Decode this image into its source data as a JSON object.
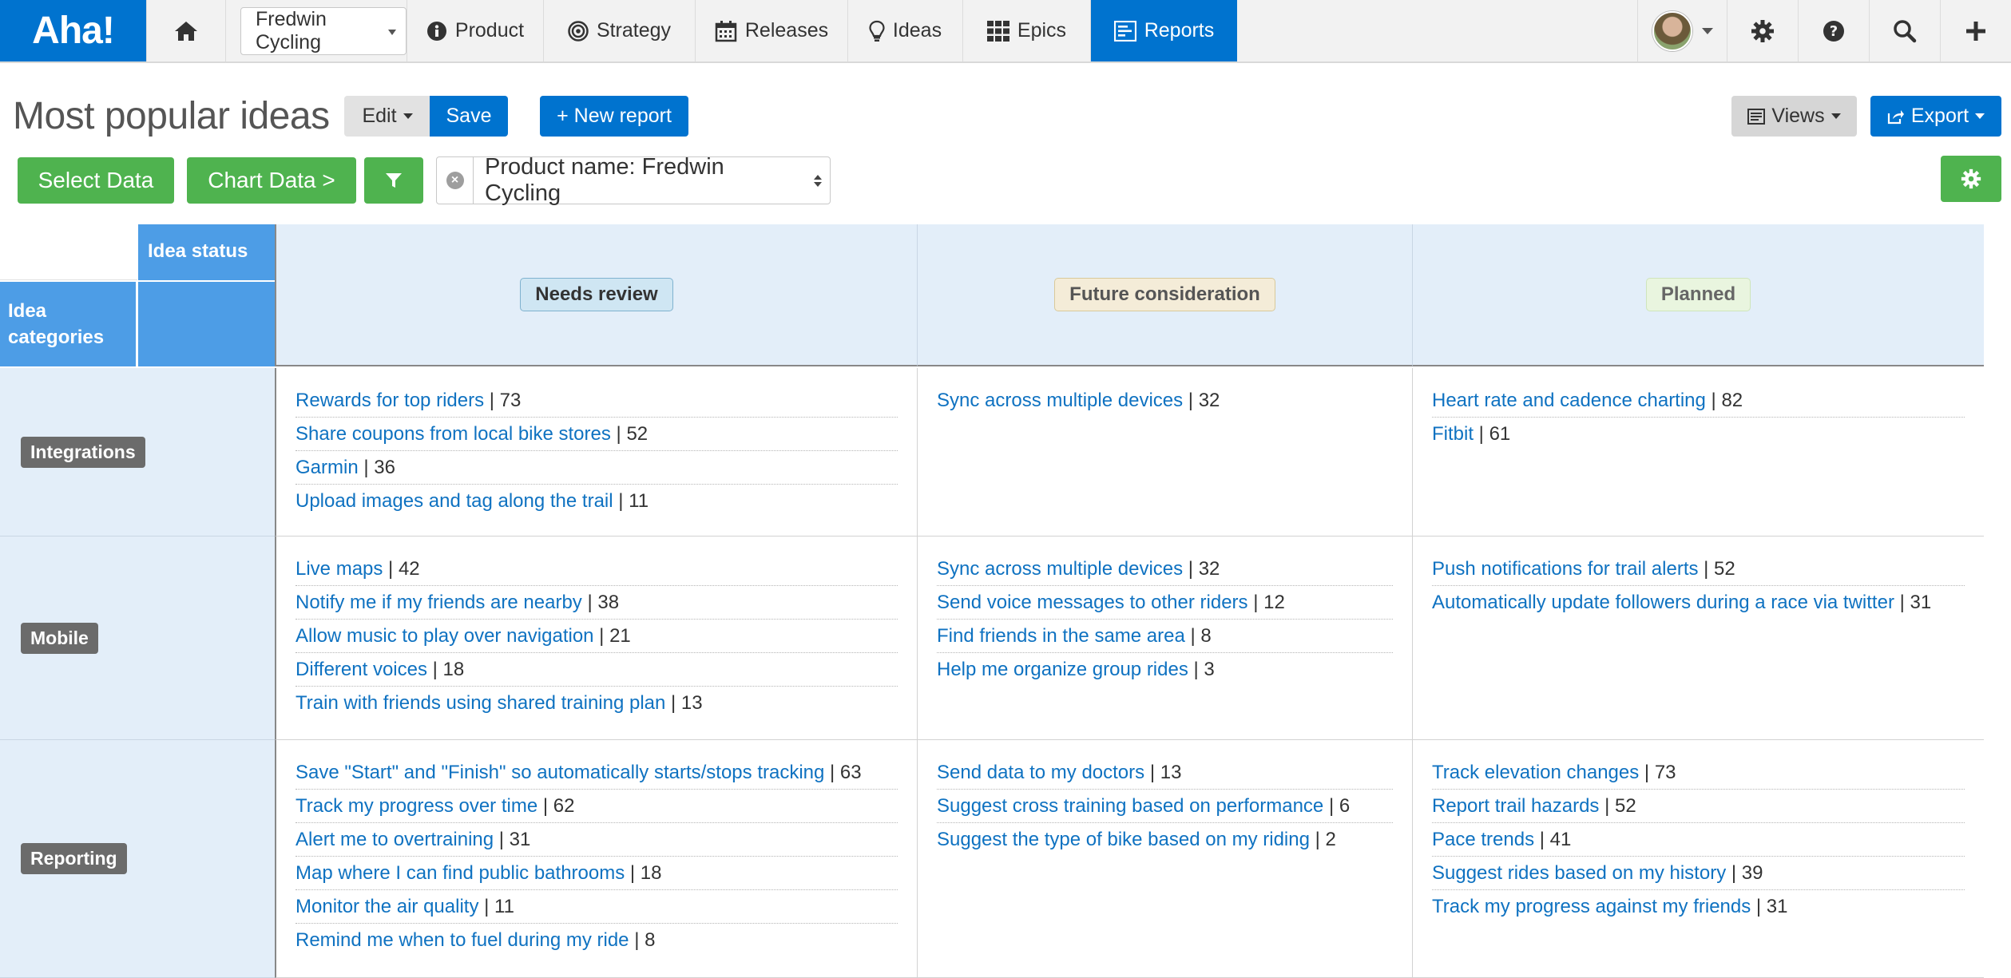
{
  "app": {
    "logo": "Aha!",
    "nav": {
      "product_select": "Fredwin Cycling",
      "items": [
        {
          "label": "Product",
          "icon": "info-circle-icon"
        },
        {
          "label": "Strategy",
          "icon": "target-icon"
        },
        {
          "label": "Releases",
          "icon": "calendar-icon"
        },
        {
          "label": "Ideas",
          "icon": "lightbulb-icon"
        },
        {
          "label": "Epics",
          "icon": "grid-icon"
        },
        {
          "label": "Reports",
          "icon": "report-icon"
        }
      ]
    }
  },
  "toolbar": {
    "title": "Most popular ideas",
    "edit_label": "Edit",
    "save_label": "Save",
    "new_report_label": "+ New report",
    "views_label": "Views",
    "export_label": "Export",
    "select_data_label": "Select Data",
    "chart_data_label": "Chart Data >",
    "filter_text": "Product name: Fredwin Cycling"
  },
  "pivot": {
    "status_header": "Idea status",
    "categories_header": "Idea categories",
    "columns": [
      "Needs review",
      "Future consideration",
      "Planned"
    ],
    "rows": [
      {
        "label": "Integrations",
        "cells": [
          [
            [
              "Rewards for top riders",
              "73"
            ],
            [
              "Share coupons from local bike stores",
              "52"
            ],
            [
              "Garmin",
              "36"
            ],
            [
              "Upload images and tag along the trail",
              "11"
            ]
          ],
          [
            [
              "Sync across multiple devices",
              "32"
            ]
          ],
          [
            [
              "Heart rate and cadence charting",
              "82"
            ],
            [
              "Fitbit",
              "61"
            ]
          ]
        ]
      },
      {
        "label": "Mobile",
        "cells": [
          [
            [
              "Live maps",
              "42"
            ],
            [
              "Notify me if my friends are nearby",
              "38"
            ],
            [
              "Allow music to play over navigation",
              "21"
            ],
            [
              "Different voices",
              "18"
            ],
            [
              "Train with friends using shared training plan",
              "13"
            ]
          ],
          [
            [
              "Sync across multiple devices",
              "32"
            ],
            [
              "Send voice messages to other riders",
              "12"
            ],
            [
              "Find friends in the same area",
              "8"
            ],
            [
              "Help me organize group rides",
              "3"
            ]
          ],
          [
            [
              "Push notifications for trail alerts",
              "52"
            ],
            [
              "Automatically update followers during a race via twitter",
              "31"
            ]
          ]
        ]
      },
      {
        "label": "Reporting",
        "cells": [
          [
            [
              "Save \"Start\" and \"Finish\" so automatically starts/stops tracking",
              "63"
            ],
            [
              "Track my progress over time",
              "62"
            ],
            [
              "Alert me to overtraining",
              "31"
            ],
            [
              "Map where I can find public bathrooms",
              "18"
            ],
            [
              "Monitor the air quality",
              "11"
            ],
            [
              "Remind me when to fuel during my ride",
              "8"
            ]
          ],
          [
            [
              "Send data to my doctors",
              "13"
            ],
            [
              "Suggest cross training based on performance",
              "6"
            ],
            [
              "Suggest the type of bike based on my riding",
              "2"
            ]
          ],
          [
            [
              "Track elevation changes",
              "73"
            ],
            [
              "Report trail hazards",
              "52"
            ],
            [
              "Pace trends",
              "41"
            ],
            [
              "Suggest rides based on my history",
              "39"
            ],
            [
              "Track my progress against my friends",
              "31"
            ]
          ]
        ]
      }
    ]
  },
  "colors": {
    "brand_blue": "#0073cf",
    "header_blue": "#4d9de6",
    "light_blue": "#e3eef9",
    "green": "#4fb34f",
    "link": "#0f72c1"
  }
}
